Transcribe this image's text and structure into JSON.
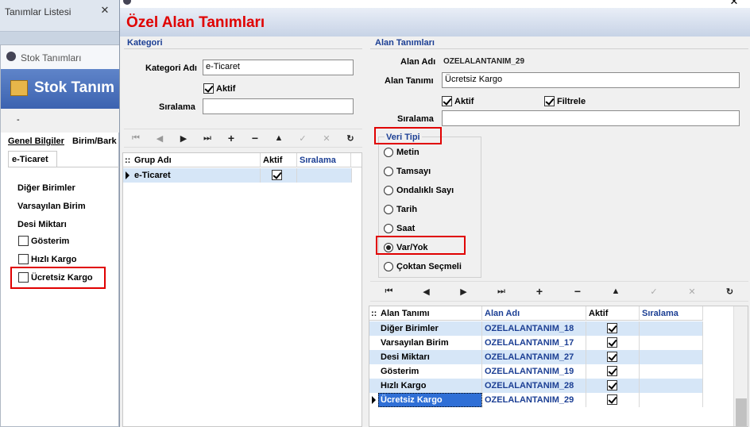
{
  "background": {
    "list_tab": "Tanımlar Listesi",
    "stok_window_title": "Stok Tanımları",
    "stok_header": "Stok Tanım",
    "dash": "-",
    "tabs": [
      "Genel Bilgiler",
      "Birim/Bark"
    ],
    "subtab": "e-Ticaret",
    "labels": [
      "Diğer Birimler",
      "Varsayılan  Birim",
      "Desi Miktarı"
    ],
    "checkboxes": [
      "Gösterim",
      "Hızlı Kargo",
      "Ücretsiz Kargo"
    ]
  },
  "dialog": {
    "title": "Özel Alan Tanımları",
    "colors": {
      "title_red": "#e00000",
      "header_blue": "#1c3f94",
      "selected_row": "#d6e6f7",
      "highlight": "#2f6fd6"
    }
  },
  "kategori": {
    "header": "Kategori",
    "name_label": "Kategori Adı",
    "name_value": "e-Ticaret",
    "active_label": "Aktif",
    "active_checked": true,
    "order_label": "Sıralama",
    "order_value": "",
    "nav_icons": [
      "first-icon",
      "prev-icon",
      "next-icon",
      "last-icon",
      "add-icon",
      "delete-icon",
      "up-icon",
      "confirm-icon",
      "cancel-icon",
      "refresh-icon"
    ],
    "nav_glyphs": [
      "⏮",
      "◀",
      "▶",
      "⏭",
      "+",
      "−",
      "▲",
      "✓",
      "✕",
      "↻"
    ],
    "grid_headers": [
      "Grup Adı",
      "Aktif",
      "Sıralama"
    ],
    "grid_rows": [
      {
        "name": "e-Ticaret",
        "active": true,
        "order": ""
      }
    ]
  },
  "alan": {
    "header": "Alan Tanımları",
    "field_name_label": "Alan Adı",
    "field_name_value": "OZELALANTANIM_29",
    "field_desc_label": "Alan Tanımı",
    "field_desc_value": "Ücretsiz Kargo",
    "active_label": "Aktif",
    "active_checked": true,
    "filter_label": "Filtrele",
    "filter_checked": true,
    "order_label": "Sıralama",
    "order_value": "",
    "veri_tipi_label": "Veri Tipi",
    "veri_tipi_options": [
      "Metin",
      "Tamsayı",
      "Ondalıklı Sayı",
      "Tarih",
      "Saat",
      "Var/Yok",
      "Çoktan Seçmeli"
    ],
    "veri_tipi_selected": "Var/Yok",
    "nav_glyphs": [
      "⏮",
      "◀",
      "▶",
      "⏭",
      "+",
      "−",
      "▲",
      "✓",
      "✕",
      "↻"
    ],
    "grid_headers": [
      "Alan Tanımı",
      "Alan Adı",
      "Aktif",
      "Sıralama"
    ],
    "grid_rows": [
      {
        "desc": "Diğer Birimler",
        "name": "OZELALANTANIM_18",
        "active": true
      },
      {
        "desc": "Varsayılan  Birim",
        "name": "OZELALANTANIM_17",
        "active": true
      },
      {
        "desc": "Desi Miktarı",
        "name": "OZELALANTANIM_27",
        "active": true
      },
      {
        "desc": "Gösterim",
        "name": "OZELALANTANIM_19",
        "active": true
      },
      {
        "desc": "Hızlı Kargo",
        "name": "OZELALANTANIM_28",
        "active": true
      },
      {
        "desc": "Ücretsiz Kargo",
        "name": "OZELALANTANIM_29",
        "active": true
      }
    ]
  }
}
